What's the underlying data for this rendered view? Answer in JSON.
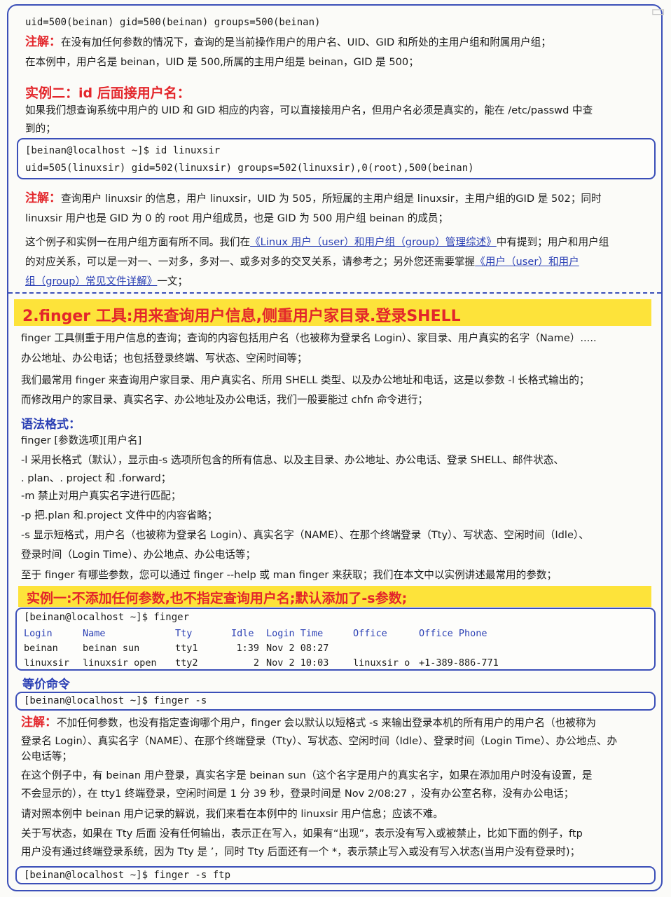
{
  "top": {
    "output_line": "uid=500(beinan) gid=500(beinan) groups=500(beinan)",
    "note_label": "注解：",
    "note1_text": "在没有加任何参数的情况下，查询的是当前操作用户的用户名、UID、GID 和所处的主用户组和附属用户组；",
    "note1_text2": "在本例中，用户名是 beinan，UID 是 500,所属的主用户组是 beinan，GID 是 500；"
  },
  "example2": {
    "heading": "实例二：id 后面接用户名：",
    "desc1": "如果我们想查询系统中用户的 UID 和 GID 相应的内容，可以直接接用户名，但用户名必须是真实的，能在 /etc/passwd 中查",
    "desc2": "到的；",
    "cmd": "[beinan@localhost ~]$ id linuxsir",
    "out": "uid=505(linuxsir) gid=502(linuxsir) groups=502(linuxsir),0(root),500(beinan)",
    "note_label": "注解：",
    "note_l1": "查询用户 linuxsir 的信息，用户 linuxsir，UID 为 505，所短属的主用户组是 linuxsir，主用户组的GID 是 502；同时",
    "note_l2": "linuxsir 用户也是 GID 为 0 的 root 用户组成员，也是 GID 为 500 用户组 beinan 的成员；",
    "para_l1_a": "这个例子和实例一在用户组方面有所不同。我们在",
    "para_l1_link": "《Linux 用户（user）和用户组（group）管理综述》",
    "para_l1_b": "中有提到；用户和用户组",
    "para_l2_a": "的对应关系，可以是一对一、一对多，多对一、或多对多的交叉关系，请参考之；另外您还需要掌握",
    "para_l2_link": "《用户（user）和用户",
    "para_l3_link": "组（group）常见文件详解》",
    "para_l3_b": "一文；"
  },
  "finger": {
    "heading": "2.finger 工具:用来查询用户信息,侧重用户家目录.登录SHELL",
    "p1": "finger 工具侧重于用户信息的查询；查询的内容包括用户名（也被称为登录名 Login）、家目录、用户真实的名字（Name）.....",
    "p2": "办公地址、办公电话；也包括登录终端、写状态、空闲时间等；",
    "p3": "我们最常用 finger 来查询用户家目录、用户真实名、所用 SHELL 类型、以及办公地址和电话，这是以参数 -l 长格式输出的；",
    "p4": "而修改用户的家目录、真实名字、办公地址及办公电话，我们一般要能过 chfn 命令进行；",
    "syntax_label": "语法格式：",
    "syntax": "finger [参数选项][用户名]",
    "opt_l": "-l 采用长格式（默认），显示由-s 选项所包含的所有信息、以及主目录、办公地址、办公电话、登录 SHELL、邮件状态、",
    "opt_l2": ". plan、. project 和 .forward；",
    "opt_m": "-m 禁止对用户真实名字进行匹配；",
    "opt_p": "-p 把.plan 和.project 文件中的内容省略；",
    "opt_s": "-s 显示短格式，用户名（也被称为登录名 Login）、真实名字（NAME）、在那个终端登录（Tty）、写状态、空闲时间（Idle）、",
    "opt_s2": "登录时间（Login Time）、办公地点、办公电话等；",
    "more": "至于 finger 有哪些参数，您可以通过 finger --help 或 man finger 来获取；我们在本文中以实例讲述最常用的参数；"
  },
  "example1": {
    "heading": "实例一:不添加任何参数,也不指定查询用户名;默认添加了-s参数;",
    "cmd": "[beinan@localhost ~]$ finger",
    "headers": [
      "Login",
      "Name",
      "Tty",
      "Idle",
      "Login Time",
      "Office",
      "Office Phone"
    ],
    "rows": [
      [
        "beinan",
        "beinan sun",
        "tty1",
        "1:39",
        "Nov  2 08:27",
        "",
        ""
      ],
      [
        "linuxsir",
        "linuxsir open",
        "tty2",
        "2",
        "Nov  2 10:03",
        "linuxsir o",
        "+1-389-886-771"
      ]
    ],
    "equiv_label": "等价命令",
    "equiv_cmd": "[beinan@localhost ~]$ finger -s",
    "note_label": "注解：",
    "n1": "不加任何参数，也没有指定查询哪个用户，finger 会以默认以短格式 -s 来输出登录本机的所有用户的用户名（也被称为",
    "n2": "登录名 Login）、真实名字（NAME）、在那个终端登录（Tty）、写状态、空闲时间（Idle）、登录时间（Login Time）、办公地点、办",
    "n3": "公电话等；",
    "n4": "在这个例子中，有 beinan 用户登录，真实名字是 beinan sun（这个名字是用户的真实名字，如果在添加用户时没有设置，是",
    "n5": "不会显示的），在 tty1 终端登录，空闲时间是 1 分 39 秒，登录时间是 Nov 2/08:27 ，没有办公室名称，没有办公电话；",
    "n6": "请对照本例中 beinan 用户记录的解说，我们来看在本例中的 linuxsir 用户信息；应该不难。",
    "n7": "关于写状态，如果在 Tty 后面 没有任何输出，表示正在写入，如果有“出现”，表示没有写入或被禁止，比如下面的例子，ftp",
    "n8": "用户没有通过终端登录系统，因为 Tty 是 ’，同时 Tty 后面还有一个 *，表示禁止写入或没有写入状态(当用户没有登录时)；",
    "last_cmd": "[beinan@localhost ~]$ finger -s ftp"
  }
}
